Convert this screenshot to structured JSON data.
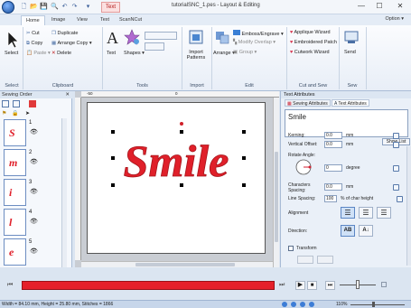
{
  "window": {
    "title": "tutorialSNC_1.pes - Layout & Editing",
    "context_tab": "Text",
    "minimize": "—",
    "maximize": "☐",
    "close": "✕"
  },
  "tabs": [
    {
      "label": "Home",
      "active": true
    },
    {
      "label": "Image",
      "active": false
    },
    {
      "label": "View",
      "active": false
    },
    {
      "label": "Text",
      "active": false
    },
    {
      "label": "ScanNCut",
      "active": false
    }
  ],
  "option_label": "Option",
  "ribbon": {
    "select": {
      "label": "Select",
      "group": "Select"
    },
    "clipboard": {
      "cut": "Cut",
      "copy": "Copy",
      "paste": "Paste",
      "duplicate": "Duplicate",
      "arrange_copy": "Arrange Copy",
      "delete": "Delete",
      "group": "Clipboard"
    },
    "tools": {
      "text": "Text",
      "shapes": "Shapes",
      "group": "Tools"
    },
    "import": {
      "label": "Import\nPatterns",
      "group": "Import"
    },
    "edit": {
      "arrange": "Arrange",
      "emboss": "Emboss/Engrave",
      "modify_overlap": "Modify Overlap",
      "group_btn": "Group",
      "group": "Edit"
    },
    "cut_sew": {
      "applique": "Applique Wizard",
      "embroidered_patch": "Embroidered Patch",
      "cutwork": "Cutwork Wizard",
      "group": "Cut and Sew"
    },
    "sew": {
      "send": "Send",
      "group": "Sew"
    }
  },
  "sewing_order": {
    "title": "Sewing Order",
    "items": [
      {
        "num": "1",
        "letter": "S"
      },
      {
        "num": "2",
        "letter": "m"
      },
      {
        "num": "3",
        "letter": "i"
      },
      {
        "num": "4",
        "letter": "l"
      },
      {
        "num": "5",
        "letter": "e"
      }
    ]
  },
  "canvas": {
    "text": "Smile",
    "ruler_marks": [
      "-50",
      "0"
    ],
    "colors": {
      "text": "#e0202a"
    }
  },
  "text_attributes": {
    "title": "Text Attributes",
    "tabs": [
      "Sewing Attributes",
      "Text Attributes"
    ],
    "text_value": "Smile",
    "show_list": "Show List",
    "kerning": {
      "label": "Kerning:",
      "value": "0.0",
      "unit": "mm"
    },
    "vertical_offset": {
      "label": "Vertical Offset:",
      "value": "0.0",
      "unit": "mm"
    },
    "rotate_angle": {
      "label": "Rotate Angle:",
      "value": "0",
      "unit": "degree"
    },
    "char_spacing": {
      "label": "Characters\nSpacing:",
      "value": "0.0",
      "unit": "mm"
    },
    "line_spacing": {
      "label": "Line Spacing:",
      "value": "100",
      "unit": "% of char height"
    },
    "alignment": "Alignment",
    "direction": "Direction:",
    "transform": "Transform"
  },
  "status": {
    "text": "Width = 84.10 mm, Height = 25.80 mm, Stitches = 1866",
    "zoom": "110%"
  }
}
